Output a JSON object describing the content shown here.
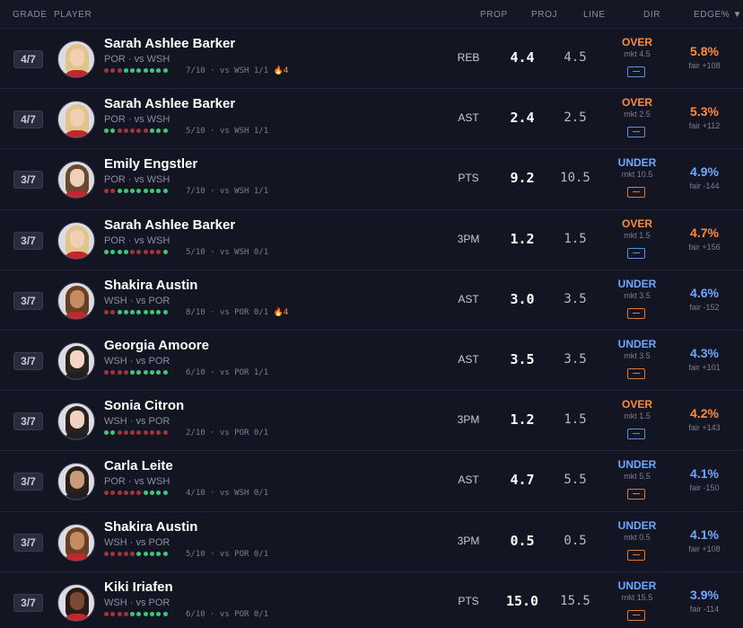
{
  "header": {
    "grade": "GRADE",
    "player": "PLAYER",
    "prop": "PROP",
    "proj": "PROJ",
    "line": "LINE",
    "dir": "DIR",
    "edge": "EDGE% ▼"
  },
  "colors": {
    "over": "#ff8c3a",
    "under": "#6ea8ff",
    "hit": "#3fc77a",
    "miss": "#a3353a",
    "background": "#12131f"
  },
  "rows": [
    {
      "grade": "4/7",
      "name": "Sarah Ashlee Barker",
      "team": "POR · vs WSH",
      "form": [
        0,
        0,
        0,
        1,
        1,
        1,
        1,
        1,
        1,
        1
      ],
      "record": "7/10 · vs WSH 1/1",
      "fire": "🔥4",
      "prop": "REB",
      "proj": "4.4",
      "line": "4.5",
      "dir": "OVER",
      "dir_class": "over",
      "mkt": "mkt 4.5",
      "toggle": "blue",
      "edge": "5.8%",
      "fair": "fair +108",
      "avatar": {
        "hair": "#e0c48a",
        "skin": "#f1cfb3",
        "shirt": "#c1272d"
      }
    },
    {
      "grade": "4/7",
      "name": "Sarah Ashlee Barker",
      "team": "POR · vs WSH",
      "form": [
        1,
        1,
        0,
        0,
        0,
        0,
        0,
        1,
        1,
        1
      ],
      "record": "5/10 · vs WSH 1/1",
      "fire": "",
      "prop": "AST",
      "proj": "2.4",
      "line": "2.5",
      "dir": "OVER",
      "dir_class": "over",
      "mkt": "mkt 2.5",
      "toggle": "blue",
      "edge": "5.3%",
      "fair": "fair +112",
      "avatar": {
        "hair": "#e0c48a",
        "skin": "#f1cfb3",
        "shirt": "#c1272d"
      }
    },
    {
      "grade": "3/7",
      "name": "Emily Engstler",
      "team": "POR · vs WSH",
      "form": [
        0,
        0,
        1,
        1,
        1,
        1,
        1,
        1,
        1,
        1
      ],
      "record": "7/10 · vs WSH 1/1",
      "fire": "",
      "prop": "PTS",
      "proj": "9.2",
      "line": "10.5",
      "dir": "UNDER",
      "dir_class": "under",
      "mkt": "mkt 10.5",
      "toggle": "orange",
      "edge": "4.9%",
      "fair": "fair -144",
      "avatar": {
        "hair": "#6b4a32",
        "skin": "#f0d0bd",
        "shirt": "#c1272d"
      }
    },
    {
      "grade": "3/7",
      "name": "Sarah Ashlee Barker",
      "team": "POR · vs WSH",
      "form": [
        1,
        1,
        1,
        1,
        0,
        0,
        0,
        0,
        0,
        1
      ],
      "record": "5/10 · vs WSH 0/1",
      "fire": "",
      "prop": "3PM",
      "proj": "1.2",
      "line": "1.5",
      "dir": "OVER",
      "dir_class": "over",
      "mkt": "mkt 1.5",
      "toggle": "blue",
      "edge": "4.7%",
      "fair": "fair +156",
      "avatar": {
        "hair": "#e0c48a",
        "skin": "#f1cfb3",
        "shirt": "#c1272d"
      }
    },
    {
      "grade": "3/7",
      "name": "Shakira Austin",
      "team": "WSH · vs POR",
      "form": [
        0,
        0,
        1,
        1,
        1,
        1,
        1,
        1,
        1,
        1
      ],
      "record": "8/10 · vs POR 0/1",
      "fire": "🔥4",
      "prop": "AST",
      "proj": "3.0",
      "line": "3.5",
      "dir": "UNDER",
      "dir_class": "under",
      "mkt": "mkt 3.5",
      "toggle": "orange",
      "edge": "4.6%",
      "fair": "fair -152",
      "avatar": {
        "hair": "#6a4025",
        "skin": "#c48c63",
        "shirt": "#c1272d"
      }
    },
    {
      "grade": "3/7",
      "name": "Georgia Amoore",
      "team": "WSH · vs POR",
      "form": [
        0,
        0,
        0,
        0,
        1,
        1,
        1,
        1,
        1,
        1
      ],
      "record": "6/10 · vs POR 1/1",
      "fire": "",
      "prop": "AST",
      "proj": "3.5",
      "line": "3.5",
      "dir": "UNDER",
      "dir_class": "under",
      "mkt": "mkt 3.5",
      "toggle": "orange",
      "edge": "4.3%",
      "fair": "fair +101",
      "avatar": {
        "hair": "#2a2420",
        "skin": "#f3d6c3",
        "shirt": "#1e1e24"
      }
    },
    {
      "grade": "3/7",
      "name": "Sonia Citron",
      "team": "WSH · vs POR",
      "form": [
        1,
        1,
        0,
        0,
        0,
        0,
        0,
        0,
        0,
        0
      ],
      "record": "2/10 · vs POR 0/1",
      "fire": "",
      "prop": "3PM",
      "proj": "1.2",
      "line": "1.5",
      "dir": "OVER",
      "dir_class": "over",
      "mkt": "mkt 1.5",
      "toggle": "blue",
      "edge": "4.2%",
      "fair": "fair +143",
      "avatar": {
        "hair": "#2b2220",
        "skin": "#efd2bf",
        "shirt": "#1e1e24"
      }
    },
    {
      "grade": "3/7",
      "name": "Carla Leite",
      "team": "POR · vs WSH",
      "form": [
        0,
        0,
        0,
        0,
        0,
        0,
        1,
        1,
        1,
        1
      ],
      "record": "4/10 · vs WSH 0/1",
      "fire": "",
      "prop": "AST",
      "proj": "4.7",
      "line": "5.5",
      "dir": "UNDER",
      "dir_class": "under",
      "mkt": "mkt 5.5",
      "toggle": "orange",
      "edge": "4.1%",
      "fair": "fair -150",
      "avatar": {
        "hair": "#2b211c",
        "skin": "#c99b78",
        "shirt": "#1e1e24"
      }
    },
    {
      "grade": "3/7",
      "name": "Shakira Austin",
      "team": "WSH · vs POR",
      "form": [
        0,
        0,
        0,
        0,
        0,
        1,
        1,
        1,
        1,
        1
      ],
      "record": "5/10 · vs POR 0/1",
      "fire": "",
      "prop": "3PM",
      "proj": "0.5",
      "line": "0.5",
      "dir": "UNDER",
      "dir_class": "under",
      "mkt": "mkt 0.5",
      "toggle": "orange",
      "edge": "4.1%",
      "fair": "fair +108",
      "avatar": {
        "hair": "#6a4025",
        "skin": "#c48c63",
        "shirt": "#c1272d"
      }
    },
    {
      "grade": "3/7",
      "name": "Kiki Iriafen",
      "team": "WSH · vs POR",
      "form": [
        0,
        0,
        0,
        0,
        1,
        1,
        1,
        1,
        1,
        1
      ],
      "record": "6/10 · vs POR 0/1",
      "fire": "",
      "prop": "PTS",
      "proj": "15.0",
      "line": "15.5",
      "dir": "UNDER",
      "dir_class": "under",
      "mkt": "mkt 15.5",
      "toggle": "orange",
      "edge": "3.9%",
      "fair": "fair -114",
      "avatar": {
        "hair": "#2a1b16",
        "skin": "#7a4a33",
        "shirt": "#c1272d"
      }
    }
  ]
}
